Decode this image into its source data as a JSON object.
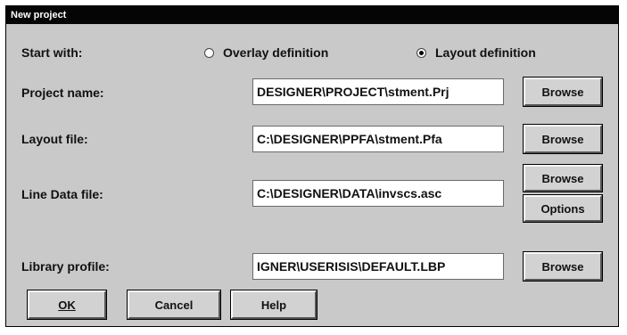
{
  "window": {
    "title": "New project"
  },
  "start_with": {
    "label": "Start with:",
    "option_overlay": "Overlay definition",
    "option_layout": "Layout definition",
    "selected": "Layout definition"
  },
  "project_name": {
    "label": "Project name:",
    "value": "DESIGNER\\PROJECT\\stment.Prj",
    "browse": "Browse"
  },
  "layout_file": {
    "label": "Layout file:",
    "value": "C:\\DESIGNER\\PPFA\\stment.Pfa",
    "browse": "Browse"
  },
  "line_data_file": {
    "label": "Line Data file:",
    "value": "C:\\DESIGNER\\DATA\\invscs.asc",
    "browse": "Browse",
    "options": "Options"
  },
  "library_profile": {
    "label": "Library profile:",
    "value": "IGNER\\USERISIS\\DEFAULT.LBP",
    "browse": "Browse"
  },
  "footer": {
    "ok": "OK",
    "cancel": "Cancel",
    "help": "Help"
  }
}
